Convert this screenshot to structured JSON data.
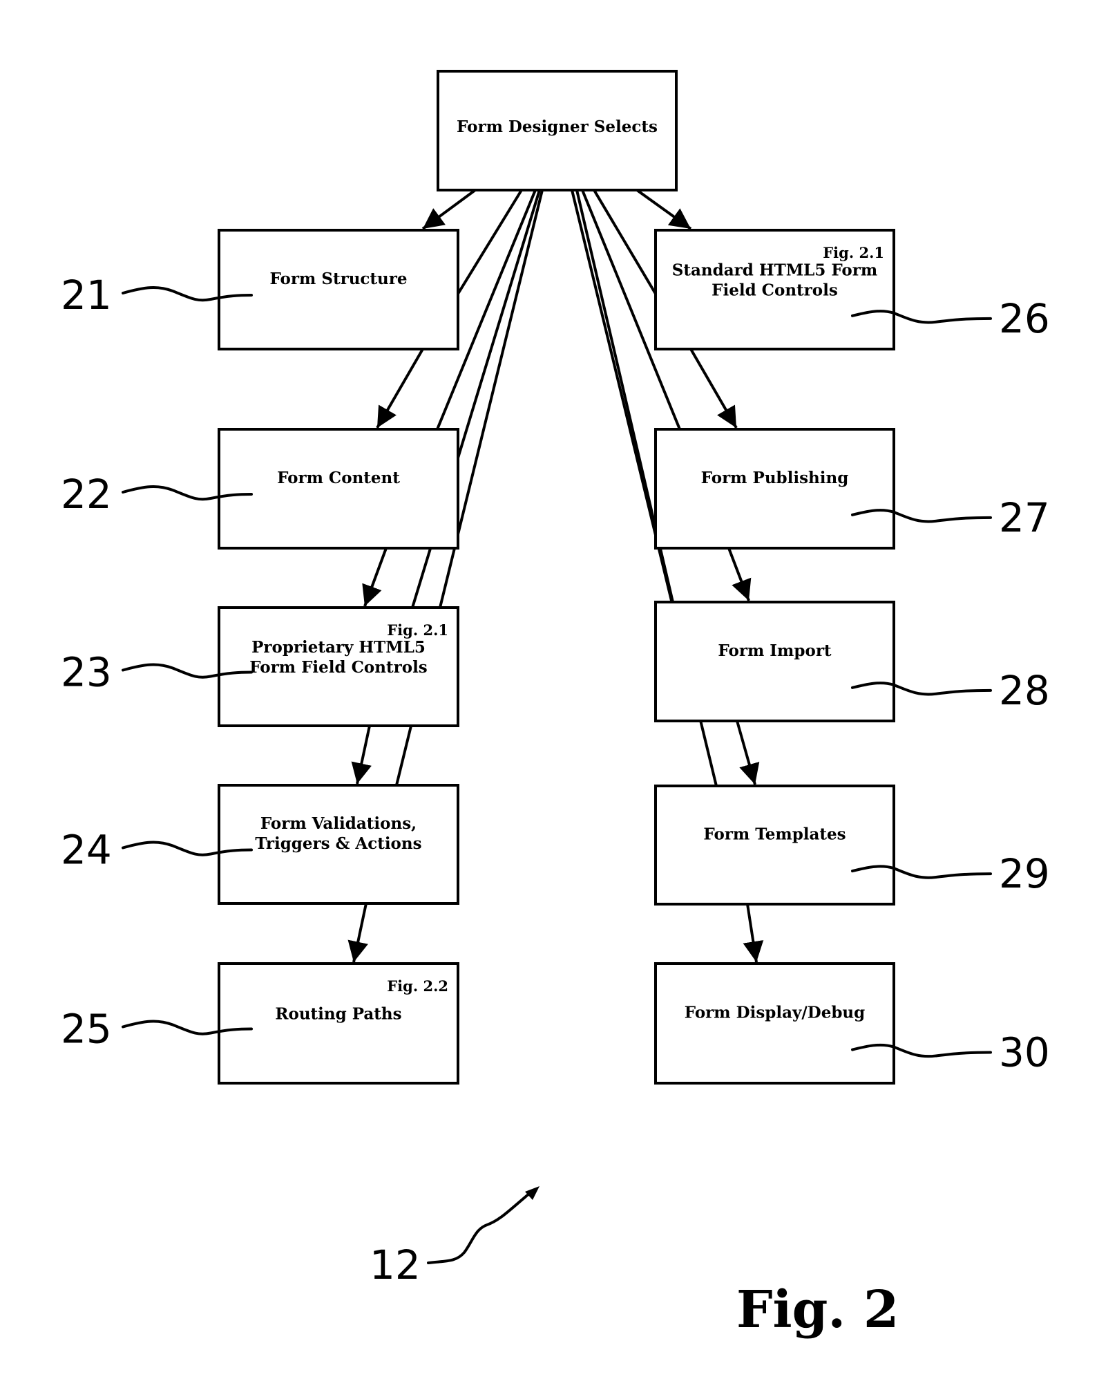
{
  "figure": {
    "title": "Fig. 2",
    "reference_numeral": "12"
  },
  "root": {
    "id": "root",
    "lines": [
      "Form Designer Selects"
    ]
  },
  "left_column": [
    {
      "id": "21",
      "numeral": "21",
      "lines": [
        "Form Structure"
      ],
      "fig_ref": ""
    },
    {
      "id": "22",
      "numeral": "22",
      "lines": [
        "Form Content"
      ],
      "fig_ref": ""
    },
    {
      "id": "23",
      "numeral": "23",
      "lines": [
        "Proprietary HTML5",
        "Form Field Controls"
      ],
      "fig_ref": "Fig. 2.1"
    },
    {
      "id": "24",
      "numeral": "24",
      "lines": [
        "Form Validations,",
        "Triggers & Actions"
      ],
      "fig_ref": ""
    },
    {
      "id": "25",
      "numeral": "25",
      "lines": [
        "Routing Paths"
      ],
      "fig_ref": "Fig. 2.2"
    }
  ],
  "right_column": [
    {
      "id": "26",
      "numeral": "26",
      "lines": [
        "Standard HTML5 Form",
        "Field Controls"
      ],
      "fig_ref": "Fig. 2.1"
    },
    {
      "id": "27",
      "numeral": "27",
      "lines": [
        "Form Publishing"
      ],
      "fig_ref": ""
    },
    {
      "id": "28",
      "numeral": "28",
      "lines": [
        "Form Import"
      ],
      "fig_ref": ""
    },
    {
      "id": "29",
      "numeral": "29",
      "lines": [
        "Form Templates"
      ],
      "fig_ref": ""
    },
    {
      "id": "30",
      "numeral": "30",
      "lines": [
        "Form Display/Debug"
      ],
      "fig_ref": ""
    }
  ],
  "connections": {
    "arrows": [
      [
        "root",
        "21"
      ],
      [
        "21",
        "22"
      ],
      [
        "22",
        "23"
      ],
      [
        "23",
        "24"
      ],
      [
        "24",
        "25"
      ],
      [
        "root",
        "26"
      ],
      [
        "26",
        "27"
      ],
      [
        "27",
        "28"
      ],
      [
        "28",
        "29"
      ],
      [
        "29",
        "30"
      ]
    ],
    "fan_lines": [
      [
        "root",
        "21"
      ],
      [
        "root",
        "22"
      ],
      [
        "root",
        "23"
      ],
      [
        "root",
        "24"
      ],
      [
        "root",
        "26"
      ],
      [
        "root",
        "27"
      ],
      [
        "root",
        "28"
      ],
      [
        "root",
        "29"
      ]
    ]
  }
}
